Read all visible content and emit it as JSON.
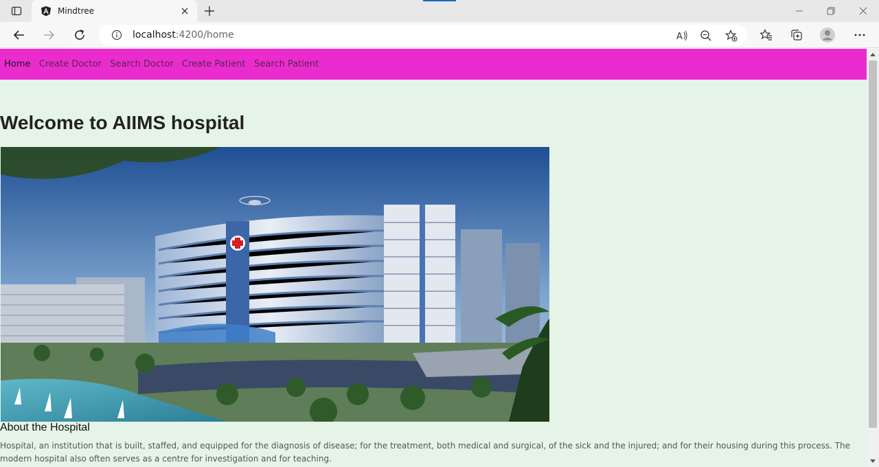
{
  "browser": {
    "tab_title": "Mindtree",
    "url_host": "localhost",
    "url_rest": ":4200/home",
    "icons": {
      "tab_actions": "tab-actions-icon",
      "favicon": "angular-logo-icon",
      "close": "close-icon",
      "new_tab": "plus-icon",
      "back": "back-arrow-icon",
      "forward": "forward-arrow-icon",
      "refresh": "refresh-icon",
      "site_info": "info-icon",
      "read_aloud": "read-aloud-icon",
      "zoom": "zoom-out-icon",
      "add_favorite": "star-plus-icon",
      "favorites": "favorites-icon",
      "collections": "collections-icon",
      "profile": "profile-icon",
      "menu": "more-icon"
    }
  },
  "site_nav": {
    "items": [
      {
        "label": "Home",
        "active": true
      },
      {
        "label": "Create Doctor"
      },
      {
        "label": "Search Doctor"
      },
      {
        "label": "Create Patient"
      },
      {
        "label": "Search Patient"
      }
    ],
    "color": "#ea2ccf"
  },
  "main": {
    "heading": "Welcome to AIIMS hospital",
    "about_title": "About the Hospital",
    "about_text": "Hospital, an institution that is built, staffed, and equipped for the diagnosis of disease; for the treatment, both medical and surgical, of the sick and the injured; and for their housing during this process. The modern hospital also often serves as a centre for investigation and for teaching.",
    "background": "#e5f4e6"
  }
}
